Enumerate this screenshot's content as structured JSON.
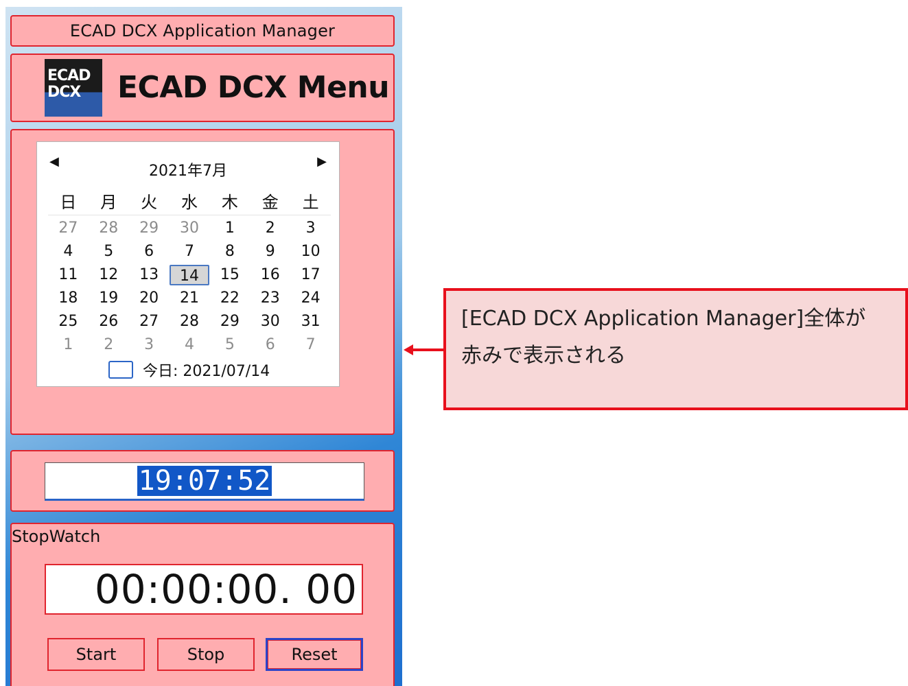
{
  "window": {
    "title": "ECAD DCX Application Manager"
  },
  "header": {
    "logo_line1": "ECAD",
    "logo_line2": "DCX",
    "title": "ECAD DCX Menu"
  },
  "calendar": {
    "month_label": "2021年7月",
    "prev_glyph": "◀",
    "next_glyph": "▶",
    "weekdays": [
      "日",
      "月",
      "火",
      "水",
      "木",
      "金",
      "土"
    ],
    "weeks": [
      [
        "27",
        "28",
        "29",
        "30",
        "1",
        "2",
        "3"
      ],
      [
        "4",
        "5",
        "6",
        "7",
        "8",
        "9",
        "10"
      ],
      [
        "11",
        "12",
        "13",
        "14",
        "15",
        "16",
        "17"
      ],
      [
        "18",
        "19",
        "20",
        "21",
        "22",
        "23",
        "24"
      ],
      [
        "25",
        "26",
        "27",
        "28",
        "29",
        "30",
        "31"
      ],
      [
        "1",
        "2",
        "3",
        "4",
        "5",
        "6",
        "7"
      ]
    ],
    "selected_day": "14",
    "today_label": "今日: 2021/07/14"
  },
  "clock": {
    "time": "19:07:52"
  },
  "stopwatch": {
    "label": "StopWatch",
    "display": "00:00:00. 00",
    "start_label": "Start",
    "stop_label": "Stop",
    "reset_label": "Reset"
  },
  "callout": {
    "line1": "[ECAD DCX Application Manager]全体が",
    "line2": "赤みで表示される"
  },
  "colors": {
    "panel_bg": "#ffadb0",
    "panel_border": "#e0242e",
    "callout_border": "#e8101c",
    "selection": "#1157c7"
  }
}
